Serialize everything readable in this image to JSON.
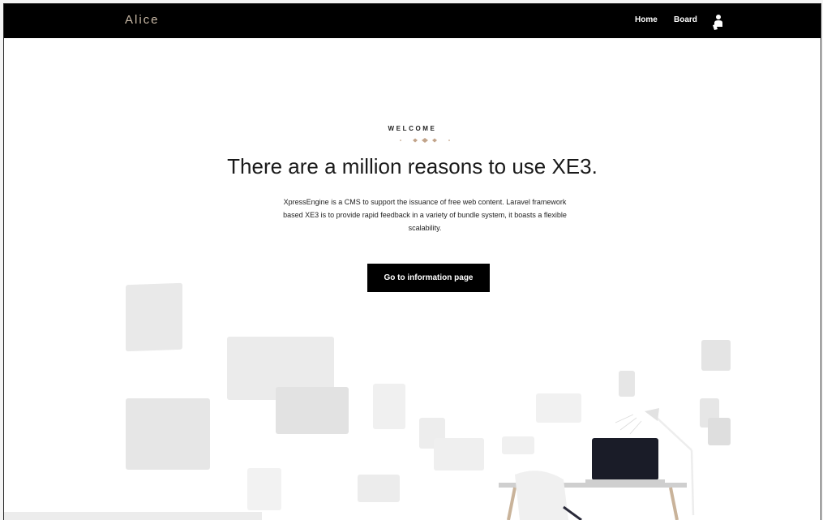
{
  "header": {
    "logo": "Alice",
    "nav": [
      {
        "label": "Home"
      },
      {
        "label": "Board"
      }
    ],
    "user_icon": "user-icon"
  },
  "hero": {
    "eyebrow": "WELCOME",
    "title": "There are a million reasons to use XE3.",
    "description_lines": [
      "XpressEngine is a CMS to support the issuance of free web content. Laravel framework",
      "based XE3 is to provide rapid feedback in a variety of bundle system, it boasts a flexible",
      "scalability."
    ],
    "cta_label": "Go to information page"
  },
  "colors": {
    "header_bg": "#000000",
    "logo": "#c9b9a6",
    "accent_dots": "#c2a48a",
    "button_bg": "#000000"
  }
}
